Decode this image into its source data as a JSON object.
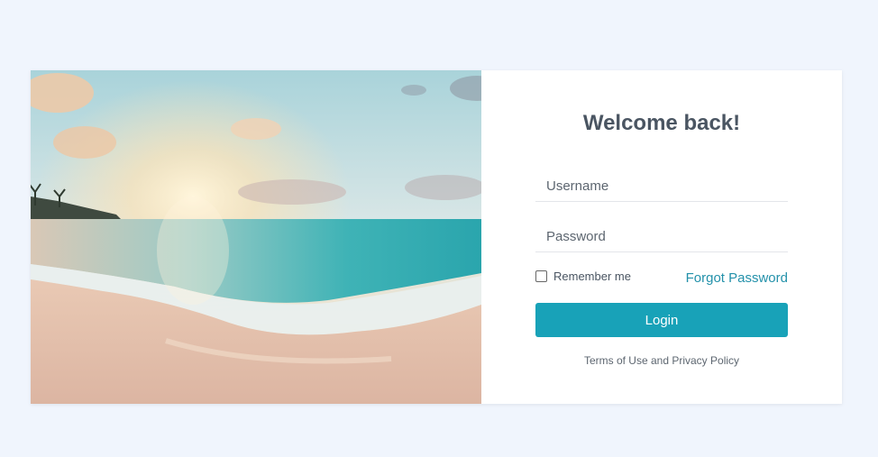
{
  "login": {
    "title": "Welcome back!",
    "username_placeholder": "Username",
    "password_placeholder": "Password",
    "remember_label": "Remember me",
    "forgot_label": "Forgot Password",
    "login_label": "Login",
    "terms_label": "Terms of Use and Privacy Policy"
  },
  "colors": {
    "page_bg": "#f0f5fd",
    "accent": "#18a2b8",
    "link": "#2391aa",
    "title": "#4a5562"
  },
  "hero_image": {
    "subject": "beach-sunset-photo"
  }
}
